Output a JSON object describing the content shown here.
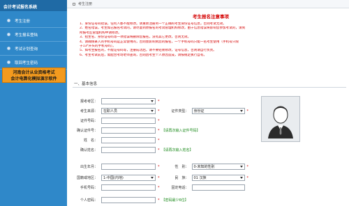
{
  "sidebar": {
    "title": "会计考试报名系统",
    "items": [
      {
        "label": "考生注册"
      },
      {
        "label": "考生报名登陆"
      },
      {
        "label": "考试计划查询"
      },
      {
        "label": "取回考生密码"
      }
    ],
    "banner": "河南会计从业资格考试\n会计电算化模拟演示软件"
  },
  "breadcrumb": "考生注册",
  "notice": {
    "title": "考生报名注意事项",
    "lines": [
      "1、身份证号码错误，任何人都不能修改。请重新注册另一个正确的考生身份证号信息，否则考试无效。",
      "2、姓名错误，考生如已报名考试的，请尽量到原报名的考试管理机构修改，由于信息错误将影响您参加考试的，请到",
      "所报考区管理机构申请修改。",
      "3、招生名、身份证号码等一项错误将删除您报名，没有其它更改，否则无效。",
      "4、请确保录入的手机号码是正常使用的，否则会影响到您的报名，一个手机号码只能一名考生使用（手机号只限",
      "于13*开头的手机号码）。",
      "5、如考生报名的，不能证号码等，注册成功后，请不要轻易修改，证号信息，否则请自行负责。",
      "6、考生考试前后，需配合考场老师查询，否则因考生个人原因造成，请按规定执行自有。"
    ]
  },
  "section": {
    "title": "一、基本信息"
  },
  "form": {
    "exam_area": {
      "label": "报考考区：",
      "value": ""
    },
    "exam_type": {
      "label": "考生来源：",
      "value": "在职人员"
    },
    "id_type": {
      "label": "证件类型：",
      "value": "身份证"
    },
    "id_number": {
      "label": "证件号码：",
      "value": ""
    },
    "confirm_id": {
      "label": "确认证件号：",
      "value": "",
      "hint": "【请再次输入证件号码】"
    },
    "name": {
      "label": "姓　名：",
      "value": ""
    },
    "confirm_name": {
      "label": "确认姓名：",
      "value": "",
      "hint": "【请再次输入姓名】"
    },
    "birthday": {
      "label": "出生年月：",
      "value": ""
    },
    "gender": {
      "label": "性　别：",
      "value": "0-未知的性别"
    },
    "nationality": {
      "label": "国籍或地区：",
      "value": "1-中国(内地)"
    },
    "ethnicity": {
      "label": "民　族：",
      "value": "01 汉族"
    },
    "mobile": {
      "label": "手机号码：",
      "value": ""
    },
    "phone": {
      "label": "固定电话：",
      "value": ""
    },
    "password": {
      "label": "个人密码：",
      "value": "",
      "hint": "【密码最少6位】"
    }
  },
  "colors": {
    "sidebar": "#2f88c9",
    "sidebar_title": "#1f6aa5",
    "banner": "#f39a1e",
    "notice_red": "#d40000",
    "hint_green": "#1a8a1a"
  }
}
